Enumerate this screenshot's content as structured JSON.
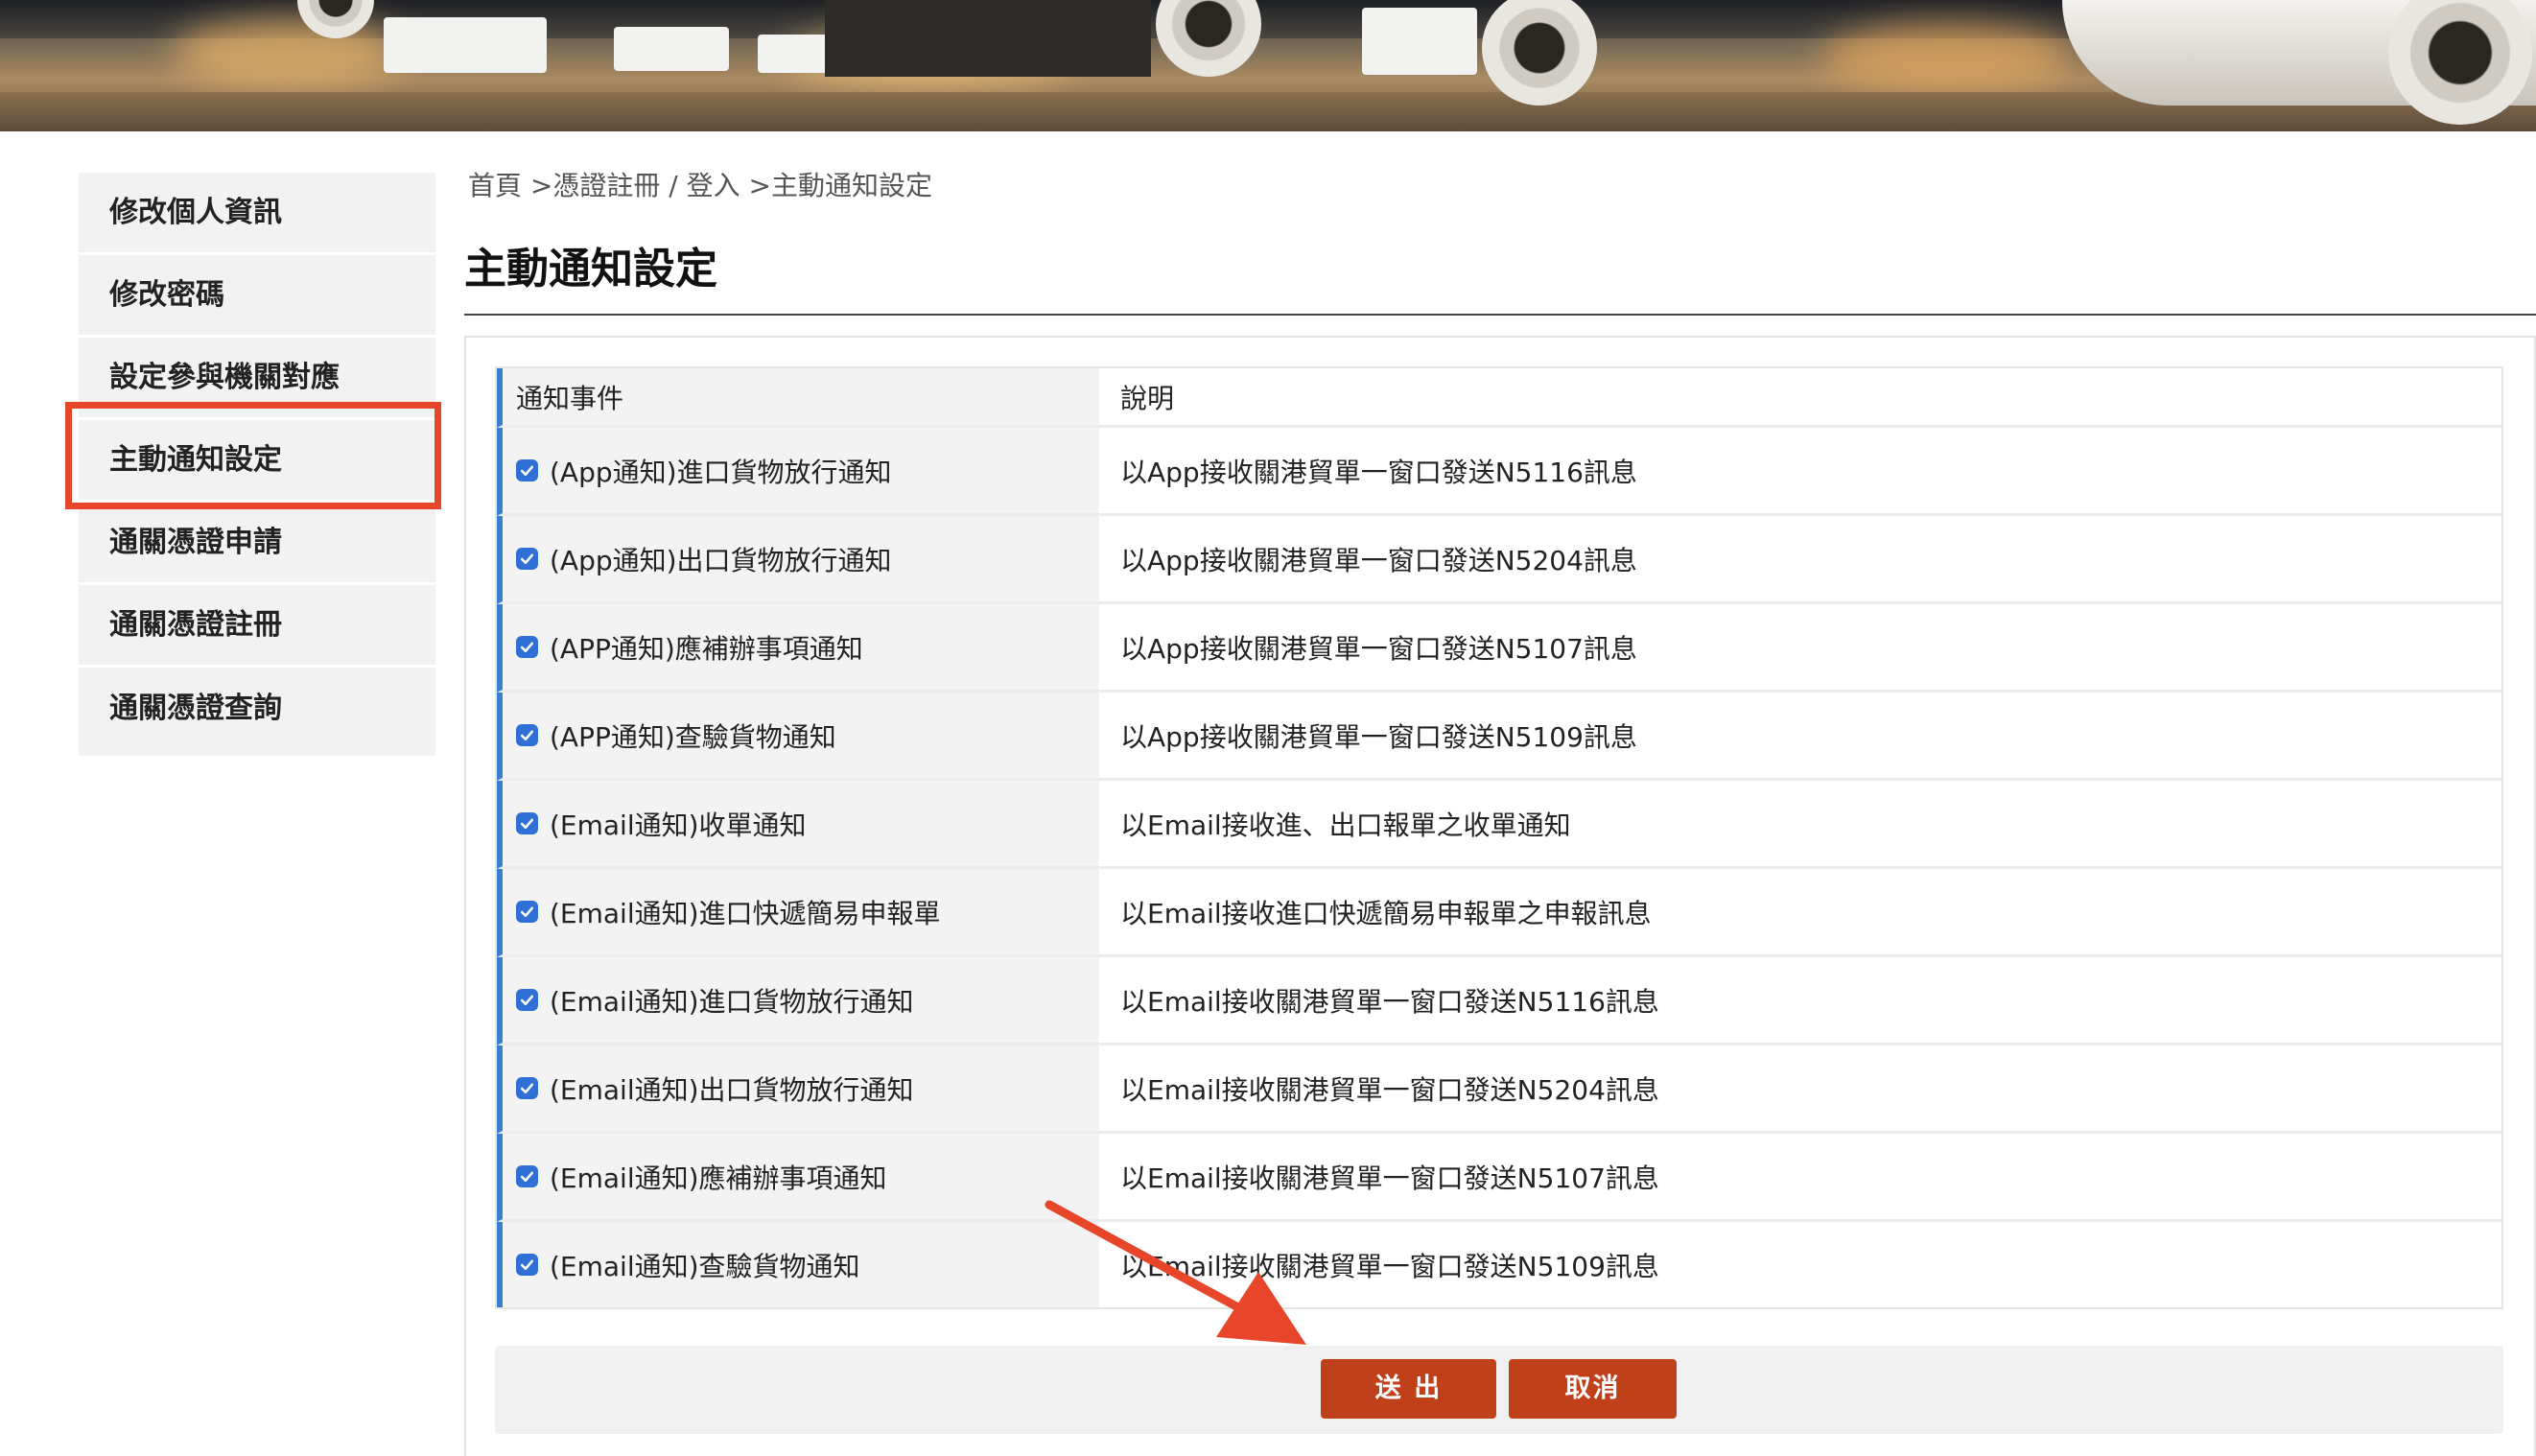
{
  "colors": {
    "accent_red": "#e8462a",
    "button_bg": "#c0401a",
    "checkbox_blue": "#2f6fd6",
    "row_marker_blue": "#3a7fc9",
    "sidebar_bg": "#f2f2f2"
  },
  "banner": {
    "image": "airport-apron-photo"
  },
  "sidebar": {
    "items": [
      {
        "label": "修改個人資訊"
      },
      {
        "label": "修改密碼"
      },
      {
        "label": "設定參與機關對應"
      },
      {
        "label": "主動通知設定",
        "active": true
      },
      {
        "label": "通關憑證申請"
      },
      {
        "label": "通關憑證註冊"
      },
      {
        "label": "通關憑證查詢"
      }
    ]
  },
  "breadcrumb": {
    "home": "首頁",
    "sep1": " >",
    "cert_register": "憑證註冊",
    "sep2": " / ",
    "login": "登入",
    "sep3": " >",
    "current": "主動通知設定"
  },
  "page": {
    "title": "主動通知設定"
  },
  "table": {
    "headers": {
      "event": "通知事件",
      "description": "說明"
    },
    "rows": [
      {
        "event": "(App通知)進口貨物放行通知",
        "description": "以App接收關港貿單一窗口發送N5116訊息",
        "checked": true
      },
      {
        "event": "(App通知)出口貨物放行通知",
        "description": "以App接收關港貿單一窗口發送N5204訊息",
        "checked": true
      },
      {
        "event": "(APP通知)應補辦事項通知",
        "description": "以App接收關港貿單一窗口發送N5107訊息",
        "checked": true
      },
      {
        "event": "(APP通知)查驗貨物通知",
        "description": "以App接收關港貿單一窗口發送N5109訊息",
        "checked": true
      },
      {
        "event": "(Email通知)收單通知",
        "description": "以Email接收進、出口報單之收單通知",
        "checked": true
      },
      {
        "event": "(Email通知)進口快遞簡易申報單",
        "description": "以Email接收進口快遞簡易申報單之申報訊息",
        "checked": true
      },
      {
        "event": "(Email通知)進口貨物放行通知",
        "description": "以Email接收關港貿單一窗口發送N5116訊息",
        "checked": true
      },
      {
        "event": "(Email通知)出口貨物放行通知",
        "description": "以Email接收關港貿單一窗口發送N5204訊息",
        "checked": true
      },
      {
        "event": "(Email通知)應補辦事項通知",
        "description": "以Email接收關港貿單一窗口發送N5107訊息",
        "checked": true
      },
      {
        "event": "(Email通知)查驗貨物通知",
        "description": "以Email接收關港貿單一窗口發送N5109訊息",
        "checked": true
      }
    ]
  },
  "actions": {
    "submit_label": "送 出",
    "cancel_label": "取消"
  }
}
